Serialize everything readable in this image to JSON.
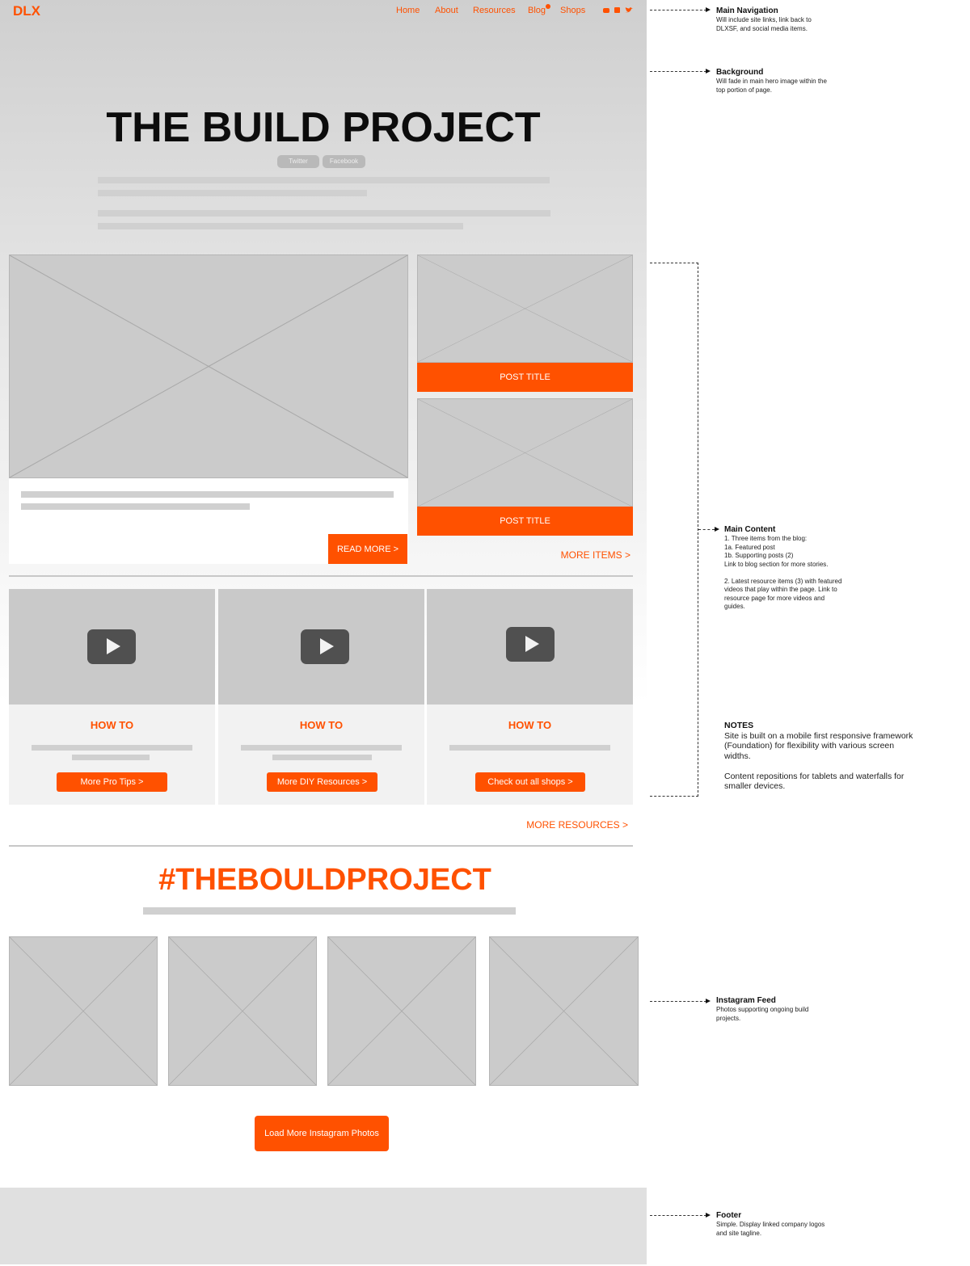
{
  "nav": {
    "logo": "DLX",
    "links": [
      "Home",
      "About",
      "Resources",
      "Blog",
      "Shops"
    ],
    "social_icons": [
      "youtube-icon",
      "facebook-icon",
      "twitter-icon"
    ]
  },
  "hero": {
    "title": "THE BUILD PROJECT",
    "pills": [
      "Twitter",
      "Facebook"
    ]
  },
  "blog": {
    "read_more": "READ MORE >",
    "post_titles": [
      "POST TITLE",
      "POST TITLE"
    ],
    "more_items": "MORE ITEMS >"
  },
  "resources": {
    "cards": [
      {
        "heading": "HOW TO",
        "button": "More Pro Tips >"
      },
      {
        "heading": "HOW TO",
        "button": "More DIY Resources >"
      },
      {
        "heading": "HOW TO",
        "button": "Check out all shops >"
      }
    ],
    "more_resources": "MORE RESOURCES >"
  },
  "instagram": {
    "hashtag": "#THEBOULDPROJECT",
    "load_more": "Load More Instagram Photos"
  },
  "notes": {
    "nav": {
      "title": "Main Navigation",
      "text": "Will include site links, link back to\nDLXSF, and social media items."
    },
    "background": {
      "title": "Background",
      "text": "Will fade in main hero image within the\ntop portion of page."
    },
    "main_content": {
      "title": "Main Content",
      "text": "1. Three items from the blog:\n      1a. Featured post\n      1b. Supporting posts (2)\nLink to blog section for more stories.\n\n2. Latest resource items (3) with featured\nvideos that play within the page. Link to\nresource page for more videos and\nguides."
    },
    "notes": {
      "title": "NOTES",
      "text": "Site is built on a mobile first responsive framework\n(Foundation) for flexibility with various screen\nwidths.\n\nContent repositions for tablets and waterfalls for\nsmaller devices."
    },
    "instagram": {
      "title": "Instagram Feed",
      "text": "Photos supporting ongoing build\nprojects."
    },
    "footer": {
      "title": "Footer",
      "text": "Simple. Display linked company logos\nand site tagline."
    }
  },
  "colors": {
    "accent": "#ff5100",
    "placeholder": "#cbcbcb",
    "footer": "#e0e0e0"
  }
}
